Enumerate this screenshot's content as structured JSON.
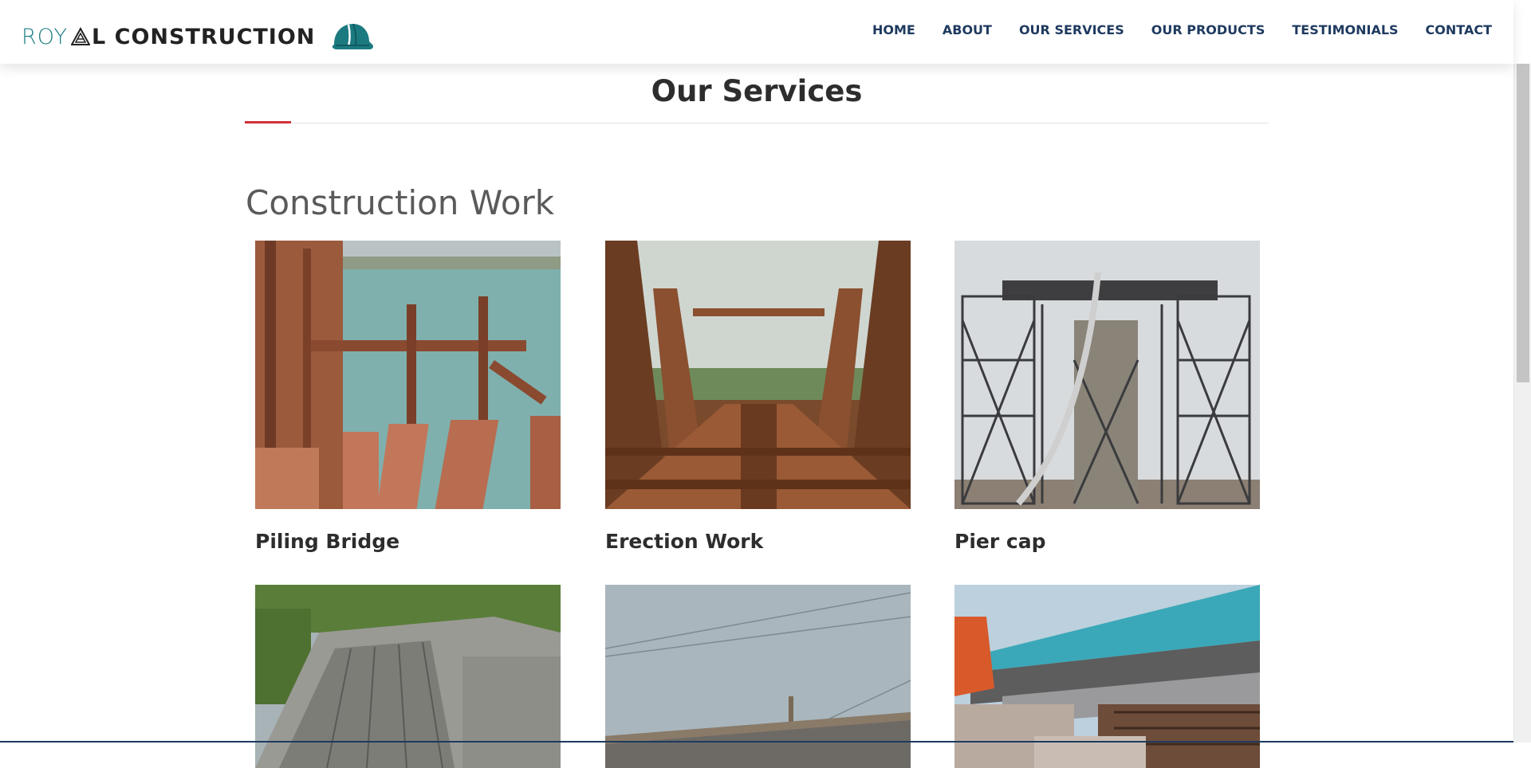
{
  "brand": {
    "part1": "ROY",
    "part2": "L CONSTRUCTION",
    "accent_color": "#1f7f86"
  },
  "nav": {
    "items": [
      "HOME",
      "ABOUT",
      "OUR SERVICES",
      "OUR PRODUCTS",
      "TESTIMONIALS",
      "CONTACT"
    ]
  },
  "section": {
    "title": "Our Services",
    "accent_color": "#d32f3a"
  },
  "category": {
    "heading": "Construction Work"
  },
  "services": [
    {
      "caption": "Piling Bridge",
      "image": "piling-bridge-photo"
    },
    {
      "caption": "Erection Work",
      "image": "erection-work-photo"
    },
    {
      "caption": "Pier cap",
      "image": "pier-cap-photo"
    },
    {
      "caption": "",
      "image": "bridge-deck-photo"
    },
    {
      "caption": "",
      "image": "steel-girder-sky-photo"
    },
    {
      "caption": "",
      "image": "railway-bridge-photo"
    }
  ]
}
